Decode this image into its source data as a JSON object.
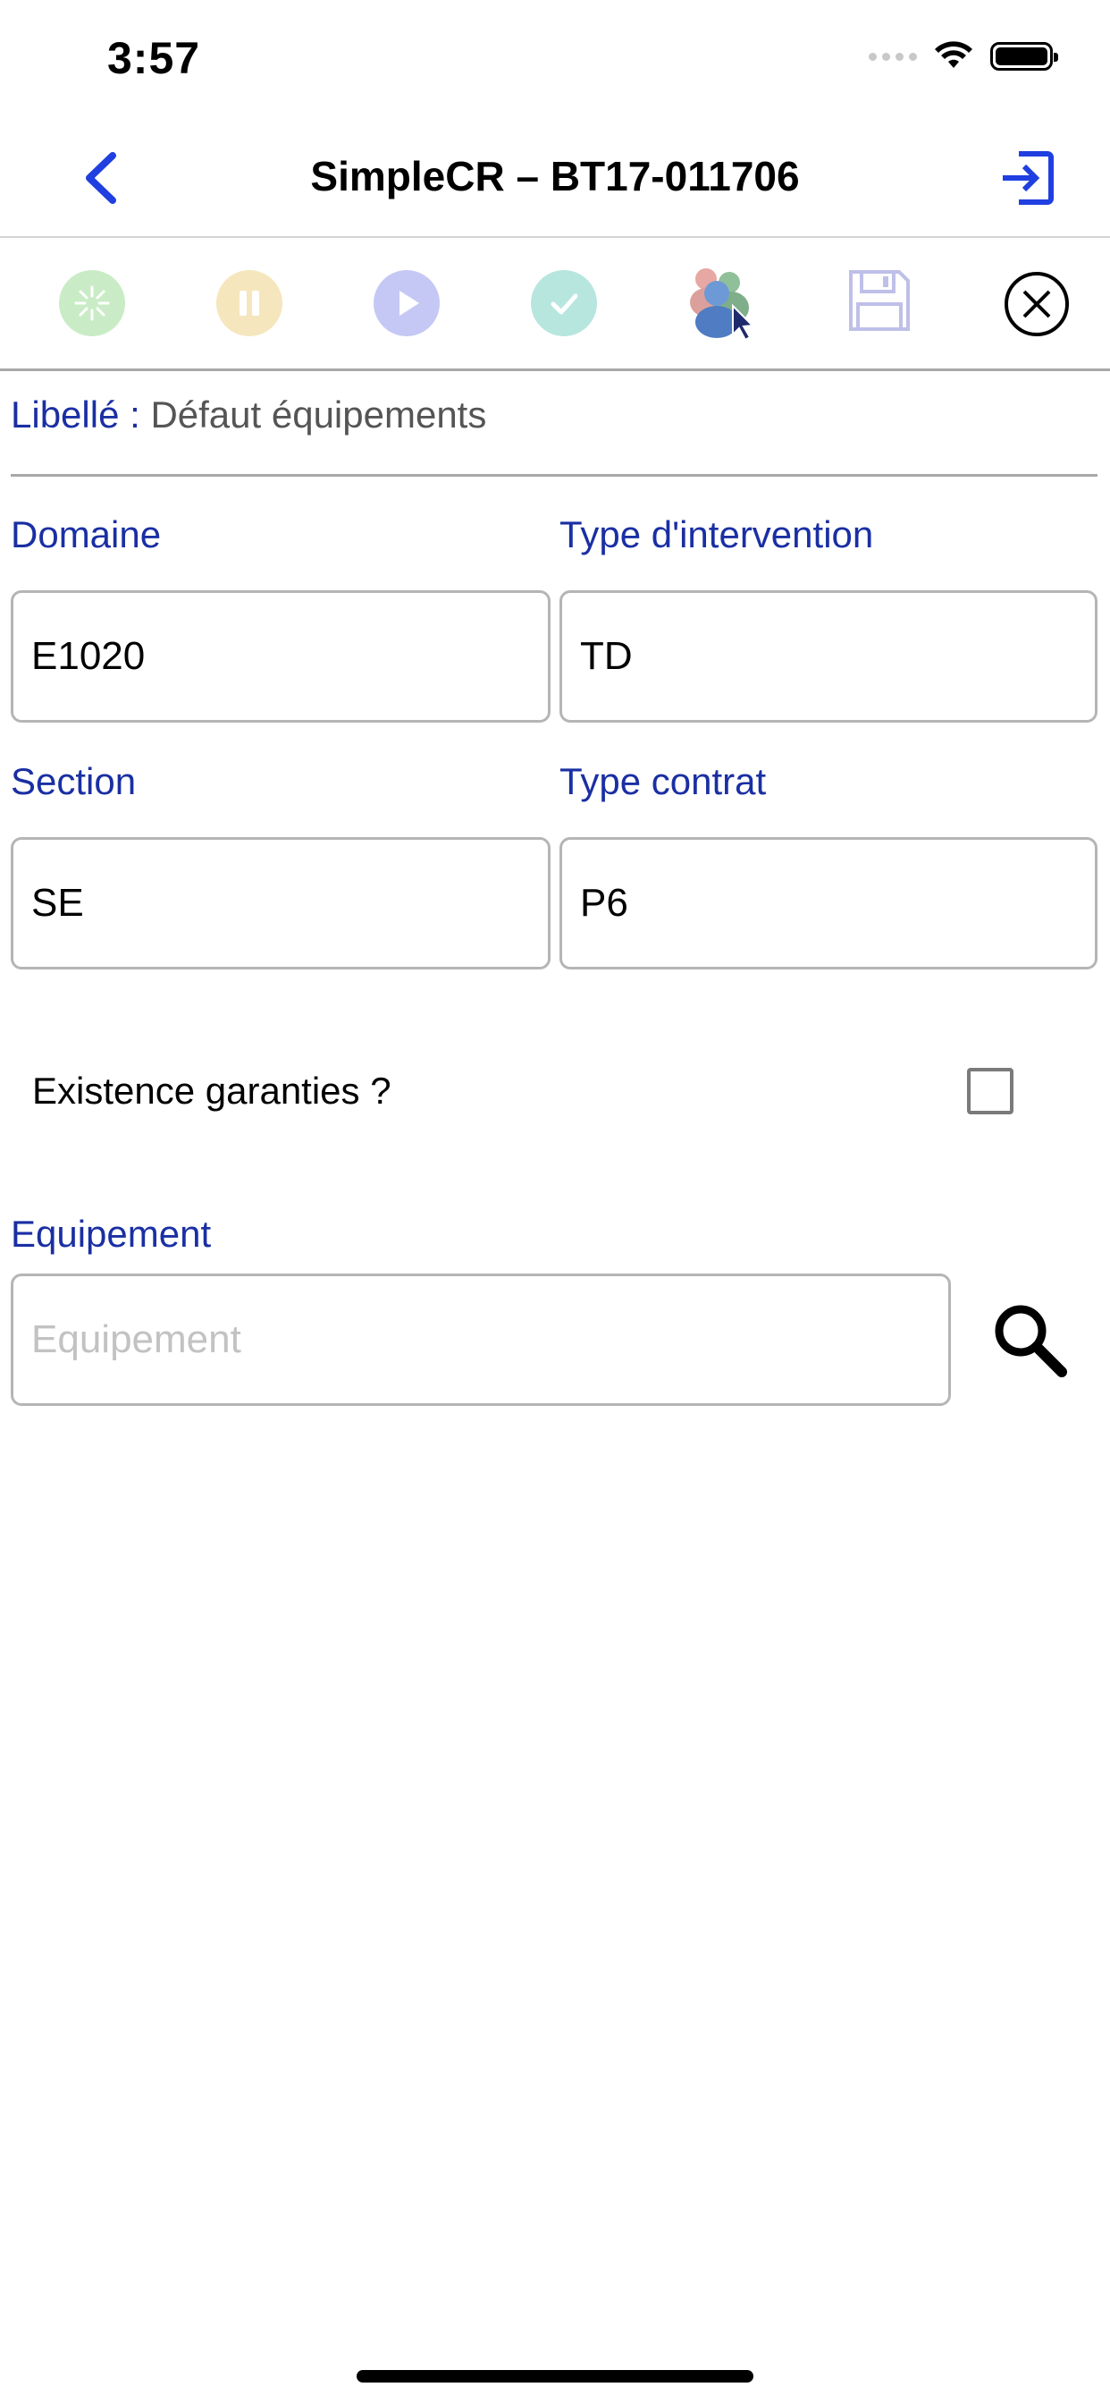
{
  "status_bar": {
    "time": "3:57"
  },
  "nav": {
    "title": "SimpleCR – BT17-011706"
  },
  "toolbar": {
    "icons": [
      "loading-icon",
      "pause-icon",
      "play-icon",
      "check-icon",
      "users-icon",
      "save-icon",
      "close-icon"
    ],
    "colors": {
      "loading": "#c9ecc6",
      "pause": "#f5e6bd",
      "play": "#c5c8f4",
      "check": "#b7e6de"
    }
  },
  "form": {
    "libelle_label": "Libellé :",
    "libelle_value": "Défaut équipements",
    "domaine": {
      "label": "Domaine",
      "value": "E1020"
    },
    "type_intervention": {
      "label": "Type d'intervention",
      "value": "TD"
    },
    "section": {
      "label": "Section",
      "value": "SE"
    },
    "type_contrat": {
      "label": "Type contrat",
      "value": "P6"
    },
    "garanties_label": "Existence garanties ?",
    "garanties_checked": false,
    "equipement": {
      "label": "Equipement",
      "value": "",
      "placeholder": "Equipement"
    }
  },
  "colors": {
    "accent": "#1a2fa3",
    "label": "#1a2fa3",
    "nav_icon": "#1f3fe0"
  }
}
